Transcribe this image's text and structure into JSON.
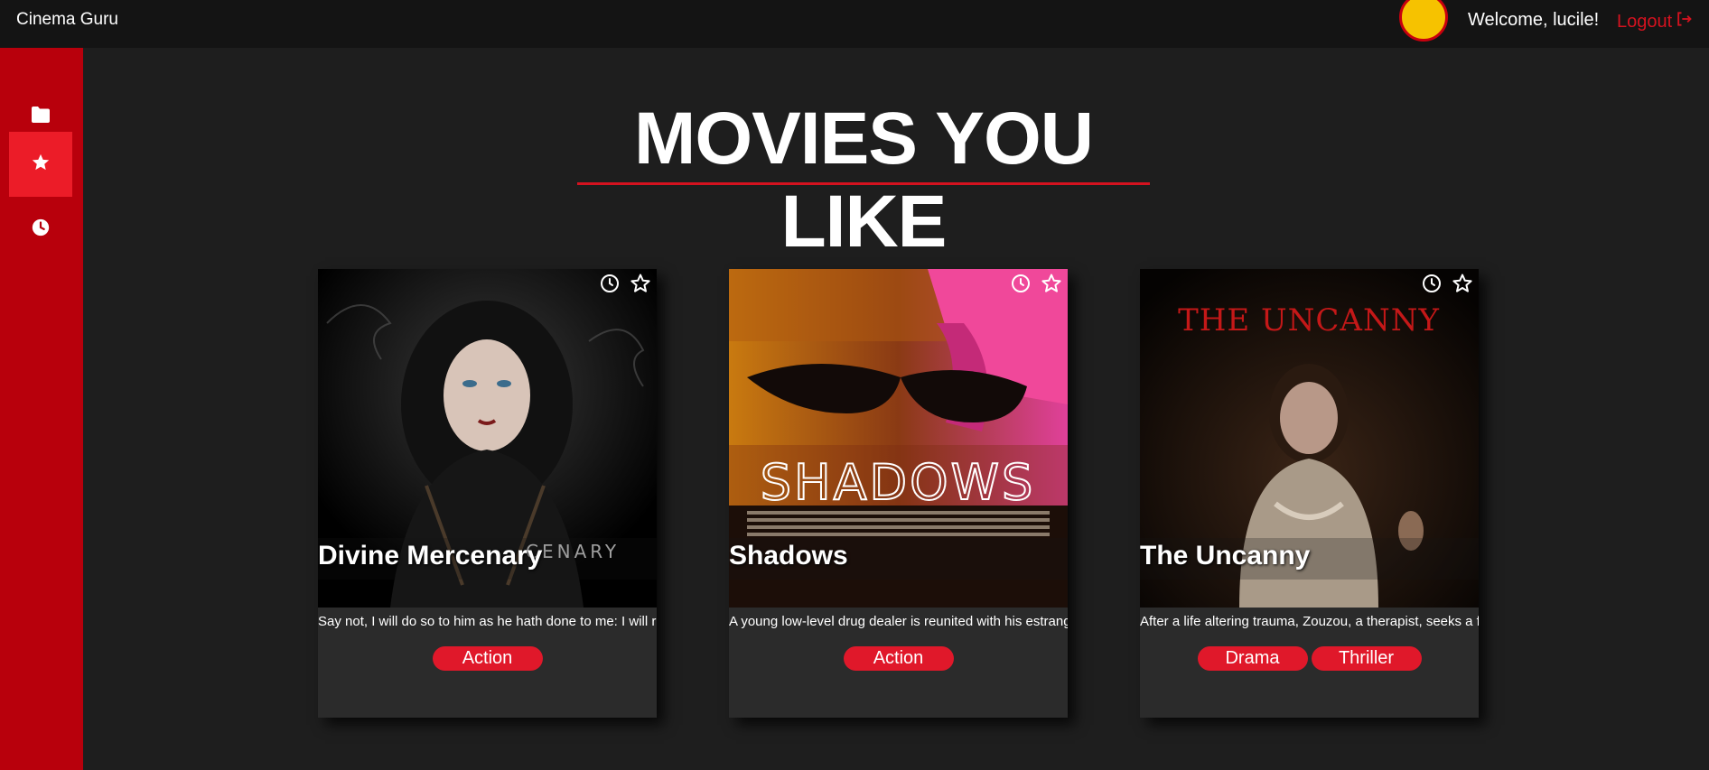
{
  "header": {
    "app_title": "Cinema Guru",
    "welcome_text": "Welcome, lucile!",
    "logout_label": "Logout"
  },
  "sidebar": {
    "items": [
      {
        "icon": "folder-icon",
        "active": false
      },
      {
        "icon": "star-icon",
        "active": true
      },
      {
        "icon": "clock-icon",
        "active": false
      }
    ]
  },
  "main": {
    "title": "MOVIES YOU LIKE"
  },
  "movies": [
    {
      "title": "Divine Mercenary",
      "synopsis": "Say not, I will do so to him as he hath done to me: I will re",
      "tags": [
        "Action"
      ],
      "poster_text": "CENARY"
    },
    {
      "title": "Shadows",
      "synopsis": "A young low-level drug dealer is reunited with his estrang",
      "tags": [
        "Action"
      ],
      "poster_text": "SHADOWS"
    },
    {
      "title": "The Uncanny",
      "synopsis": "After a life altering trauma, Zouzou, a therapist, seeks a f",
      "tags": [
        "Drama",
        "Thriller"
      ],
      "poster_text": "THE UNCANNY"
    }
  ],
  "colors": {
    "accent": "#d4121f",
    "sidebar": "#b8000c",
    "sidebar_active": "#ec1c28",
    "background": "#1e1e1e",
    "topbar": "#141414",
    "tag": "#e0182a"
  }
}
